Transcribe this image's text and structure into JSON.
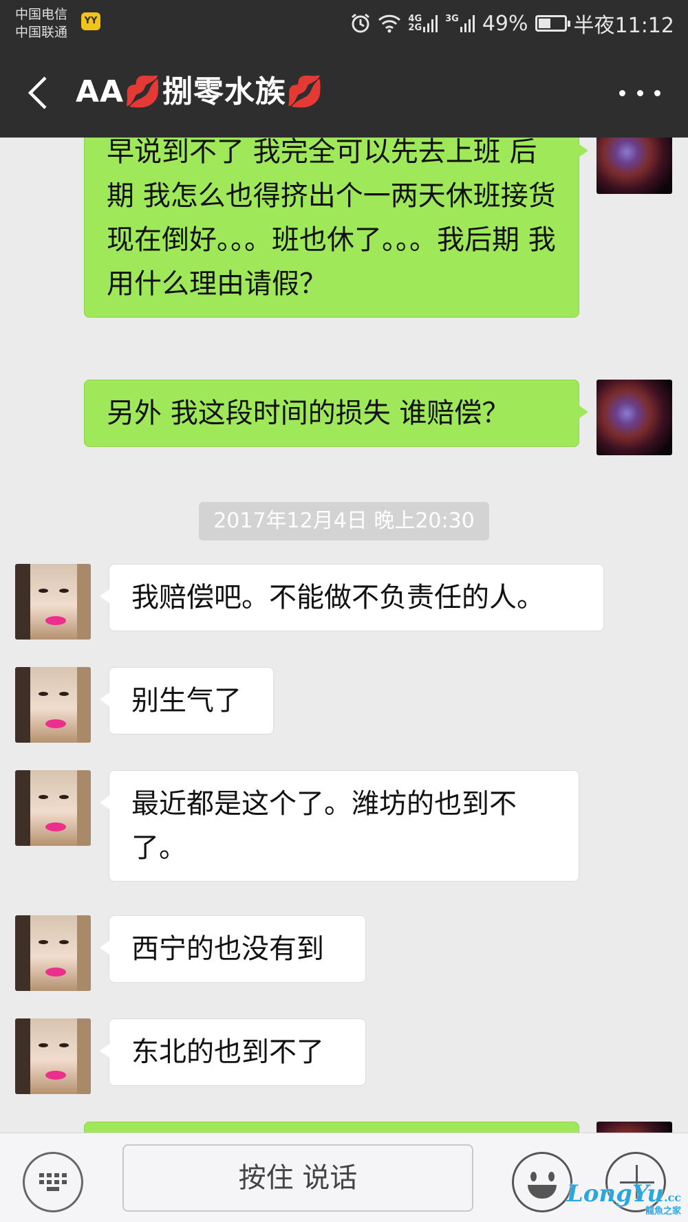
{
  "status_bar": {
    "carrier_1": "中国电信",
    "carrier_2": "中国联通",
    "app_badge": "YY",
    "net_4g": "4G",
    "net_2g": "2G",
    "net_3g": "3G",
    "battery": "49%",
    "battery_level": 0.49,
    "time": "半夜11:12"
  },
  "header": {
    "title": "AA💋捌零水族💋",
    "icons": {
      "back": "back-arrow-icon",
      "more": "more-dots-icon"
    }
  },
  "messages": {
    "m1": {
      "text": "早说到不了 我完全可以先去上班 后期 我怎么也得挤出个一两天休班接货 现在倒好。。。班也休了。。。我后期 我用什么理由请假？"
    },
    "m2": {
      "text": "另外 我这段时间的损失 谁赔偿？"
    },
    "timestamp": "2017年12月4日 晚上20:30",
    "m3": {
      "text": "我赔偿吧。不能做不负责任的人。"
    },
    "m4": {
      "text": "别生气了"
    },
    "m5": {
      "text": "最近都是这个了。潍坊的也到不了。"
    },
    "m6": {
      "text": "西宁的也没有到"
    },
    "m7": {
      "text": "东北的也到不了"
    }
  },
  "input_bar": {
    "hold_to_talk": "按住 说话",
    "icons": {
      "keyboard": "keyboard-icon",
      "emoji": "emoji-icon",
      "plus": "plus-icon"
    }
  },
  "watermark": {
    "brand": "LongYu",
    "tld": ".cc",
    "tagline": "龍魚之家"
  }
}
